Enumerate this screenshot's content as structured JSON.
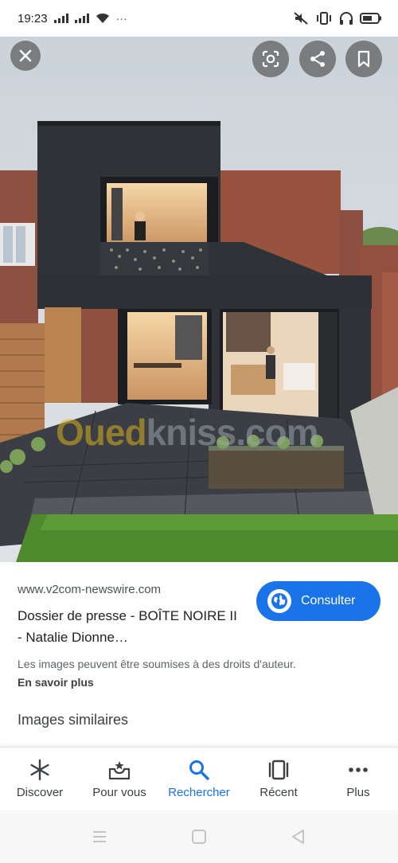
{
  "status_bar": {
    "time": "19:23",
    "dots": "···"
  },
  "image_overlay": {
    "watermark_part1": "Oued",
    "watermark_part2": "kniss.com"
  },
  "result": {
    "source": "www.v2com-newswire.com",
    "title": "Dossier de presse - BOÎTE NOIRE II - Natalie Dionne…",
    "visit_button": "Consulter",
    "copyright_notice": "Les images peuvent être soumises à des droits d'auteur.",
    "learn_more": "En savoir plus",
    "similar_images": "Images similaires"
  },
  "bottom_nav": {
    "items": [
      {
        "label": "Discover",
        "icon": "asterisk-icon"
      },
      {
        "label": "Pour vous",
        "icon": "inbox-star-icon"
      },
      {
        "label": "Rechercher",
        "icon": "search-icon",
        "active": true
      },
      {
        "label": "Récent",
        "icon": "recent-tabs-icon"
      },
      {
        "label": "Plus",
        "icon": "more-dots-icon"
      }
    ]
  },
  "colors": {
    "accent": "#1a73e8",
    "text_primary": "#202124",
    "text_secondary": "#5f6368"
  }
}
